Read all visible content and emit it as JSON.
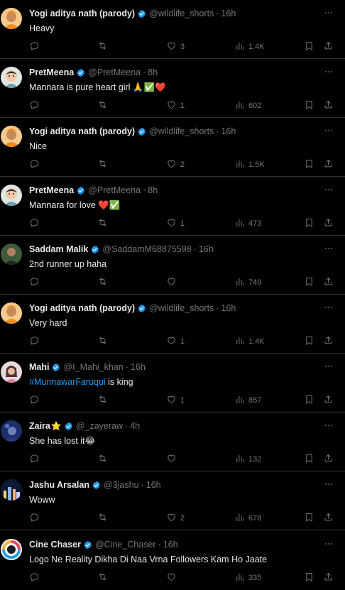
{
  "tweets": [
    {
      "name": "Yogi aditya nath (parody)",
      "handle": "@wildlife_shorts",
      "time": "16h",
      "text": "Heavy",
      "likes": "3",
      "views": "1.4K",
      "avatar": "saffron"
    },
    {
      "name": "PretMeena",
      "handle": "@PretMeena",
      "time": "8h",
      "text": "Mannara is pure heart girl 🙏✅❤️",
      "likes": "1",
      "views": "602",
      "avatar": "cartoon"
    },
    {
      "name": "Yogi aditya nath (parody)",
      "handle": "@wildlife_shorts",
      "time": "16h",
      "text": "Nice",
      "likes": "2",
      "views": "1.5K",
      "avatar": "saffron"
    },
    {
      "name": "PretMeena",
      "handle": "@PretMeena",
      "time": "8h",
      "text": "Mannara for love ❤️✅",
      "likes": "1",
      "views": "473",
      "avatar": "cartoon"
    },
    {
      "name": "Saddam Malik",
      "handle": "@SaddamM68875598",
      "time": "16h",
      "text": "2nd runner up haha",
      "likes": "",
      "views": "749",
      "avatar": "photo-green"
    },
    {
      "name": "Yogi aditya nath (parody)",
      "handle": "@wildlife_shorts",
      "time": "16h",
      "text": "Very hard",
      "likes": "1",
      "views": "1.4K",
      "avatar": "saffron"
    },
    {
      "name": "Mahi",
      "handle": "@I_Mahi_khan",
      "time": "16h",
      "text_hashtag": "#MunnawarFaruqui",
      "text": " is king",
      "likes": "1",
      "views": "857",
      "avatar": "photo-pink"
    },
    {
      "name": "Zaira",
      "name_emoji": "⭐",
      "handle": "@_zayeraw",
      "time": "4h",
      "text": "She has lost it😂",
      "likes": "",
      "views": "132",
      "avatar": "photo-blue"
    },
    {
      "name": "Jashu Arsalan",
      "handle": "@3jashu",
      "time": "16h",
      "text": "Woww",
      "likes": "2",
      "views": "678",
      "avatar": "photo-city"
    },
    {
      "name": "Cine Chaser",
      "handle": "@Cine_Chaser",
      "time": "16h",
      "text": "Logo Ne Reality Dikha Di Naa Vrna Followers Kam Ho Jaate",
      "likes": "",
      "views": "335",
      "avatar": "lens"
    }
  ],
  "colors": {
    "background": "#000000",
    "text": "#e7e9ea",
    "muted": "#71767b",
    "accent": "#1d9bf0",
    "divider": "#2f3336"
  },
  "icons": [
    "verified-badge-icon",
    "more-icon",
    "reply-icon",
    "retweet-icon",
    "like-icon",
    "views-icon",
    "bookmark-icon",
    "share-icon"
  ]
}
